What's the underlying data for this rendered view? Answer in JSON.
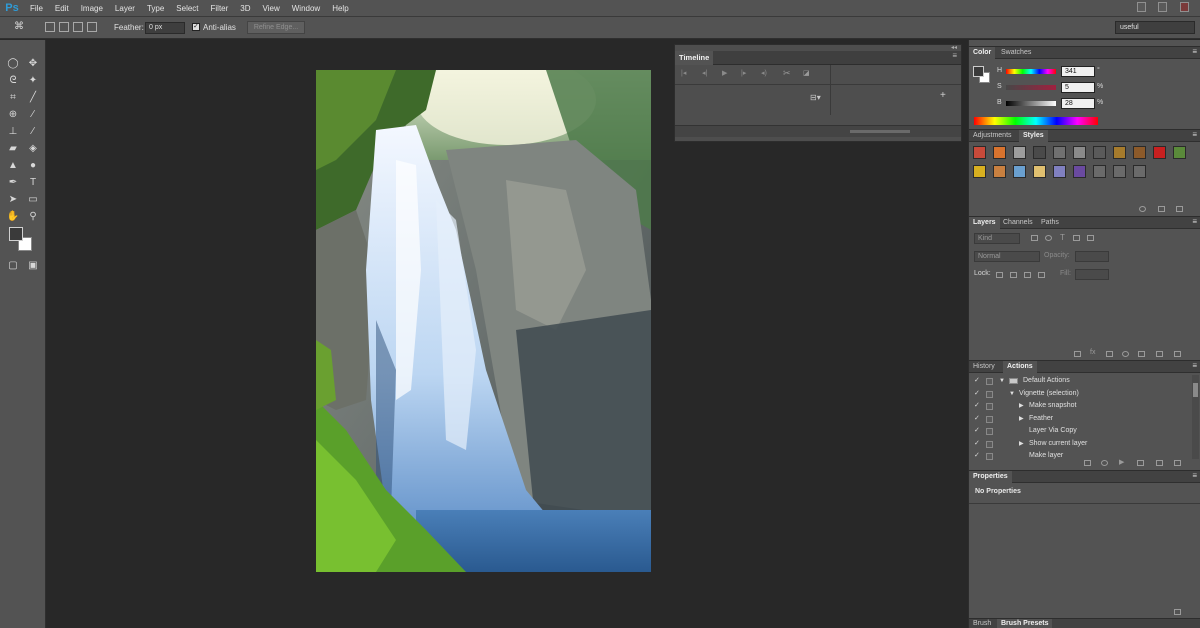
{
  "app": {
    "logo": "Ps"
  },
  "menu": [
    "File",
    "Edit",
    "Image",
    "Layer",
    "Type",
    "Select",
    "Filter",
    "3D",
    "View",
    "Window",
    "Help"
  ],
  "options_bar": {
    "feather_label": "Feather:",
    "feather_value": "0 px",
    "antialias_label": "Anti-alias",
    "antialias_checked": "✓",
    "refine_edge": "Refine Edge...",
    "workspace": "useful"
  },
  "timeline": {
    "title": "Timeline",
    "frame_rate_icon": "film-icon",
    "add_label": "+"
  },
  "color_panel": {
    "tabs": [
      "Color",
      "Swatches"
    ],
    "h_label": "H",
    "h_value": "341",
    "h_unit": "°",
    "s_label": "S",
    "s_value": "5",
    "s_unit": "%",
    "b_label": "B",
    "b_value": "28",
    "b_unit": "%"
  },
  "styles_panel": {
    "tabs": [
      "Adjustments",
      "Styles"
    ],
    "swatch_colors": [
      "#c84a3a",
      "#d8732e",
      "#9d9d9d",
      "#4a4a4a",
      "#707070",
      "#8a8a8a",
      "#5a5a5a",
      "#a67b2c",
      "#8c5a2a",
      "#c82020",
      "#5a8a3a",
      "#d8b020",
      "#c88040",
      "#6aa0d0",
      "#e0c070",
      "#8080c0",
      "#6a4aa0",
      "#6a6a6a",
      "#6a6a6a",
      "#6a6a6a"
    ]
  },
  "layers_panel": {
    "tabs": [
      "Layers",
      "Channels",
      "Paths"
    ],
    "kind": "Kind",
    "blend_mode": "Normal",
    "opacity_label": "Opacity:",
    "lock_label": "Lock:",
    "fill_label": "Fill:"
  },
  "actions_panel": {
    "tabs": [
      "History",
      "Actions"
    ],
    "rows": [
      {
        "check": "✓",
        "label": "Default Actions",
        "level": 0,
        "expanded": "▼",
        "folder": true
      },
      {
        "check": "✓",
        "label": "Vignette (selection)",
        "level": 1,
        "expanded": "▼",
        "folder": false
      },
      {
        "check": "✓",
        "label": "Make snapshot",
        "level": 2,
        "expanded": "▶",
        "folder": false
      },
      {
        "check": "✓",
        "label": "Feather",
        "level": 2,
        "expanded": "▶",
        "folder": false
      },
      {
        "check": "✓",
        "label": "Layer Via Copy",
        "level": 2,
        "expanded": "",
        "folder": false
      },
      {
        "check": "✓",
        "label": "Show current layer",
        "level": 2,
        "expanded": "▶",
        "folder": false
      },
      {
        "check": "✓",
        "label": "Make layer",
        "level": 2,
        "expanded": "",
        "folder": false
      }
    ]
  },
  "properties_panel": {
    "title": "Properties",
    "message": "No Properties"
  },
  "bottom_tabs": [
    "Brush",
    "Brush Presets"
  ]
}
